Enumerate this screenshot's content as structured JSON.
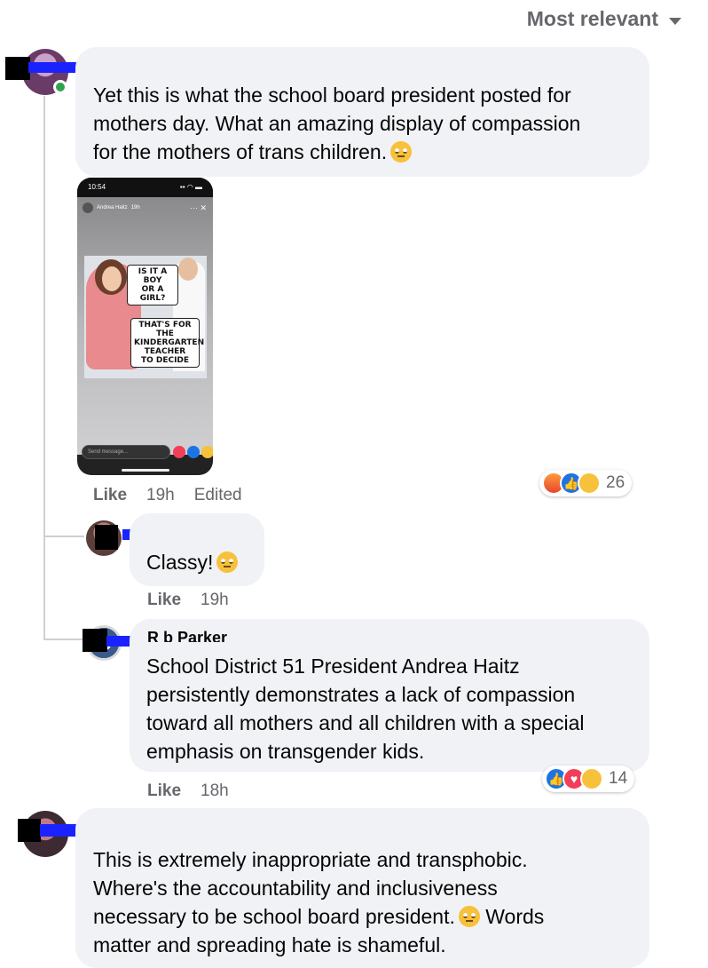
{
  "sort": {
    "label": "Most relevant"
  },
  "comments": [
    {
      "text": "Yet this is what the school board president posted for\nmothers day. What an amazing display of compassion\nfor the mothers of trans children.",
      "meta": {
        "like": "Like",
        "time": "19h",
        "edited": "Edited"
      },
      "reaction_count": "26",
      "reaction_icons": [
        "angry-icon",
        "like-icon",
        "wow-icon"
      ],
      "attachment": {
        "status_time": "10:54",
        "story_author": "Andrea Haitz",
        "story_age": "19h",
        "meme_top": "IS IT A BOY\nOR A GIRL?",
        "meme_bottom": "THAT'S FOR THE\nKINDERGARTEN\nTEACHER\nTO DECIDE",
        "send_placeholder": "Send message..."
      }
    },
    {
      "text": "Classy!",
      "meta": {
        "like": "Like",
        "time": "19h"
      }
    },
    {
      "name_fragment": "R b    Parker",
      "text": "School District 51 President Andrea Haitz\npersistently demonstrates a lack of compassion\ntoward all mothers and all children with a special\nemphasis on transgender kids.",
      "meta": {
        "like": "Like",
        "time": "18h"
      },
      "reaction_count": "14",
      "reaction_icons": [
        "like-icon",
        "love-icon",
        "sad-icon"
      ]
    },
    {
      "text": "This is extremely inappropriate and transphobic.\nWhere's the accountability and inclusiveness\nnecessary to be school board president.",
      "text_after": "Words\nmatter and spreading hate is shameful."
    }
  ],
  "colors": {
    "redaction": "#1a23ff",
    "online": "#31a24c",
    "accent": "#1b74e4"
  }
}
